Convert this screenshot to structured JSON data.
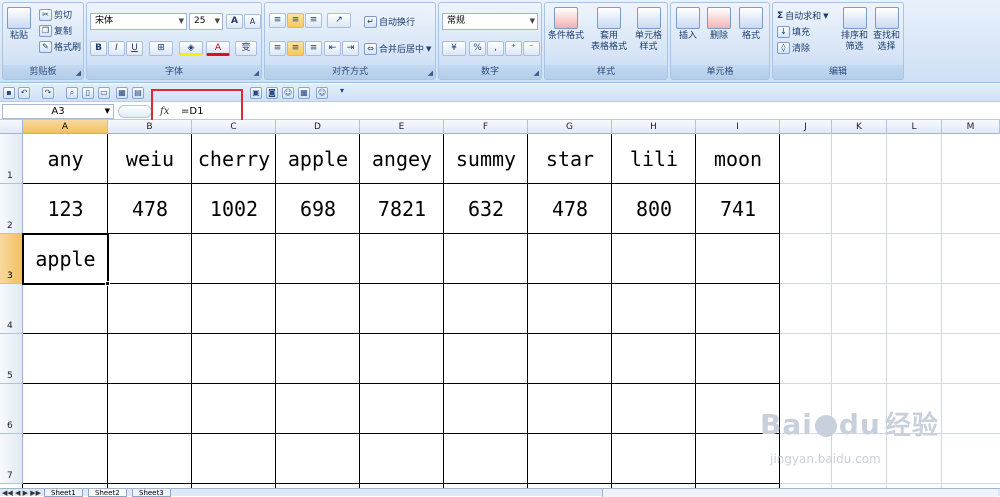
{
  "ribbon": {
    "clipboard": {
      "title": "剪贴板",
      "paste": "粘贴",
      "cut": "剪切",
      "copy": "复制",
      "format_painter": "格式刷"
    },
    "font": {
      "title": "字体",
      "name": "宋体",
      "size": "25",
      "grow": "A",
      "shrink": "A",
      "bold": "B",
      "italic": "I",
      "underline": "U",
      "phonetic": "变"
    },
    "alignment": {
      "title": "对齐方式",
      "wrap": "自动换行",
      "merge": "合并后居中"
    },
    "number": {
      "title": "数字",
      "format": "常规",
      "percent": "%",
      "comma": ","
    },
    "styles": {
      "title": "样式",
      "conditional": "条件格式",
      "table_fmt_1": "套用",
      "table_fmt_2": "表格格式",
      "cell_styles_1": "单元格",
      "cell_styles_2": "样式"
    },
    "cells": {
      "title": "单元格",
      "insert": "插入",
      "delete": "删除",
      "format": "格式"
    },
    "editing": {
      "title": "编辑",
      "autosum": "自动求和",
      "fill": "填充",
      "clear": "清除",
      "sort_1": "排序和",
      "sort_2": "筛选",
      "find_1": "查找和",
      "find_2": "选择"
    }
  },
  "formula_bar": {
    "name_box": "A3",
    "fx": "fx",
    "formula": "=D1"
  },
  "columns": [
    "A",
    "B",
    "C",
    "D",
    "E",
    "F",
    "G",
    "H",
    "I",
    "J",
    "K",
    "L",
    "M"
  ],
  "rows": [
    "1",
    "2",
    "3",
    "4",
    "5",
    "6",
    "7"
  ],
  "cells": {
    "row1": [
      "any",
      "weiu",
      "cherry",
      "apple",
      "angey",
      "summy",
      "star",
      "lili",
      "moon"
    ],
    "row2": [
      "123",
      "478",
      "1002",
      "698",
      "7821",
      "632",
      "478",
      "800",
      "741"
    ],
    "row3": [
      "apple"
    ]
  },
  "sheets": [
    "Sheet1",
    "Sheet2",
    "Sheet3"
  ],
  "watermark": {
    "brand": "Bai",
    "suffix": "du",
    "cn": "经验",
    "url": "jingyan.baidu.com"
  }
}
